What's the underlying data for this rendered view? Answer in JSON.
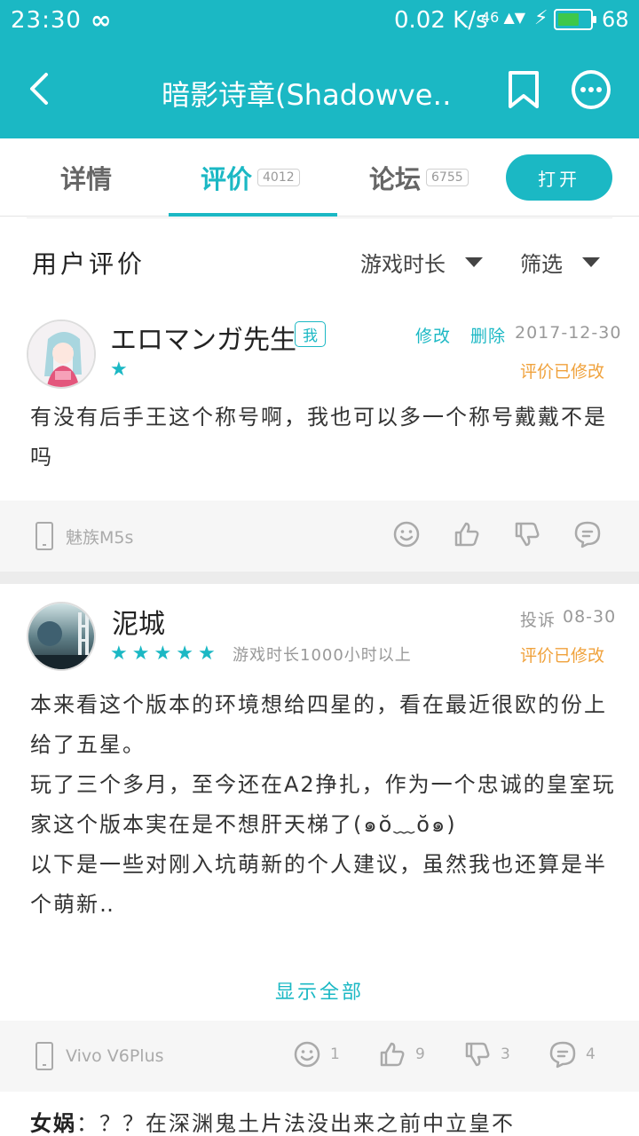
{
  "status_bar": {
    "time": "23:30",
    "loop_symbol": "∞",
    "net_speed": "0.02 K/s",
    "signal": "46 ▲▼",
    "charge_symbol": "⚡",
    "battery_level": 0.68,
    "battery_text": "68"
  },
  "title_bar": {
    "title": "暗影诗章(Shadowve‥"
  },
  "tabs": [
    {
      "label": "详情",
      "count": ""
    },
    {
      "label": "评价",
      "count": "4012"
    },
    {
      "label": "论坛",
      "count": "6755"
    }
  ],
  "open_button": "打开",
  "section": {
    "title": "用户评价",
    "sort_playtime": "游戏时长",
    "sort_filter": "筛选"
  },
  "reviews": [
    {
      "username": "エロマンガ先生",
      "badge": "我",
      "edit_link": "修改",
      "delete_link": "删除",
      "date": "2017-12-30",
      "rating": 1,
      "edited_note": "评价已修改",
      "text": "有没有后手王这个称号啊，我也可以多一个称号戴戴不是吗",
      "device": "魅族M5s",
      "counts": {
        "emoji": "",
        "like": "",
        "dislike": "",
        "comment": ""
      }
    },
    {
      "username": "泥城",
      "report_link": "投诉",
      "date": "08-30",
      "rating": 5,
      "playtime": "游戏时长1000小时以上",
      "edited_note": "评价已修改",
      "text": "本来看这个版本的环境想给四星的，看在最近很欧的份上给了五星。\n玩了三个多月，至今还在A2挣扎，作为一个忠诚的皇室玩家这个版本実在是不想肝天梯了(๑ŏ﹏ŏ๑)\n以下是一些对刚入坑萌新的个人建议，虽然我也还算是半个萌新‥",
      "show_all": "显示全部",
      "device": "Vivo V6Plus",
      "counts": {
        "emoji": "1",
        "like": "9",
        "dislike": "3",
        "comment": "4"
      }
    }
  ],
  "reply_preview": {
    "author": "女娲",
    "text": "：？？在深渊鬼土片法没出来之前中立皇不"
  },
  "colors": {
    "accent": "#1bb8c4",
    "edited": "#f0a23c"
  }
}
